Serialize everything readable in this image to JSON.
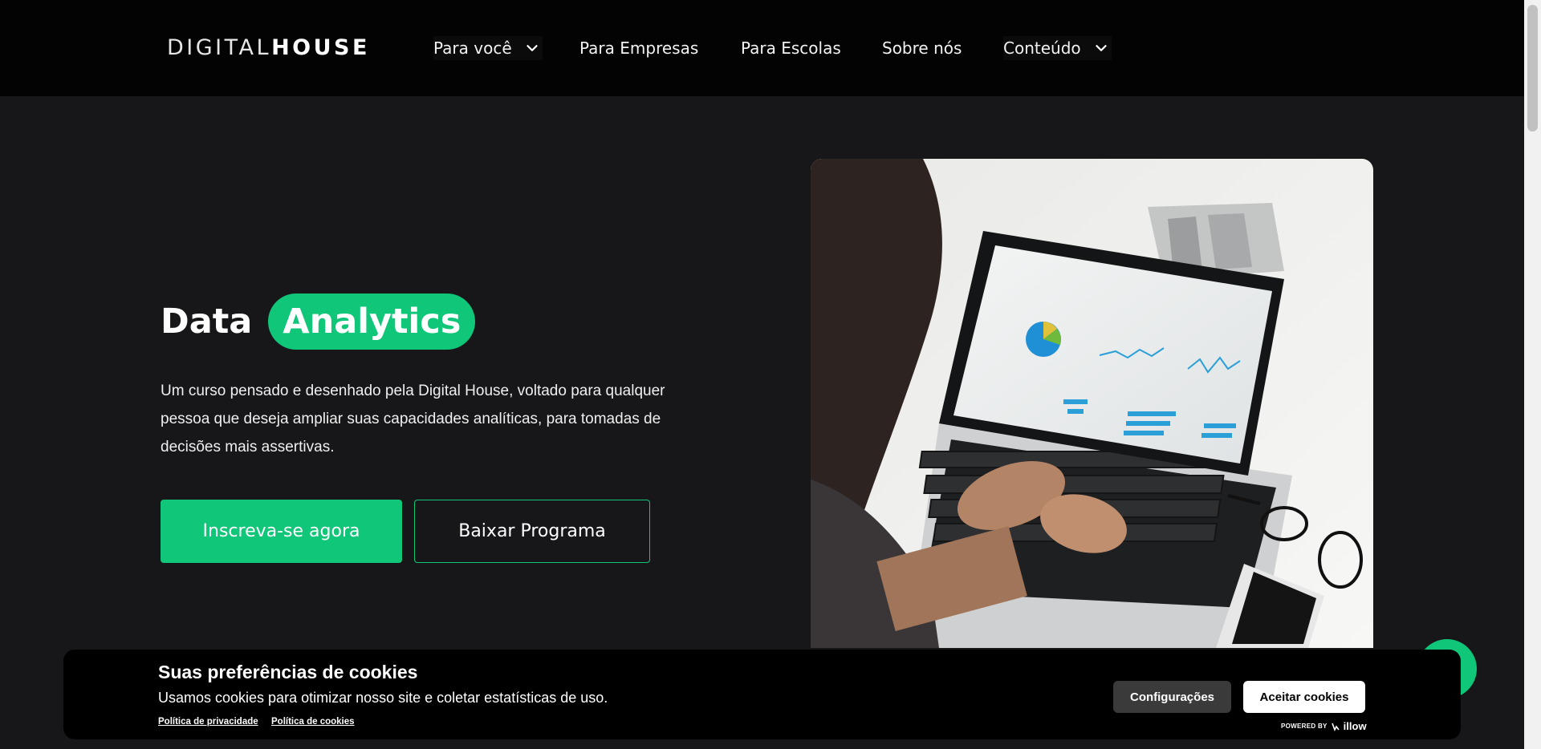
{
  "header": {
    "logo_thin": "DIGITAL",
    "logo_bold": "HOUSE",
    "nav": [
      {
        "label": "Para você",
        "dropdown": true
      },
      {
        "label": "Para Empresas",
        "dropdown": false
      },
      {
        "label": "Para Escolas",
        "dropdown": false
      },
      {
        "label": "Sobre nós",
        "dropdown": false
      },
      {
        "label": "Conteúdo",
        "dropdown": true
      }
    ]
  },
  "hero": {
    "title_word": "Data",
    "title_highlight": "Analytics",
    "description": "Um curso pensado e desenhado pela Digital House, voltado para qualquer pessoa que deseja ampliar suas capacidades analíticas, para tomadas de decisões mais assertivas.",
    "primary_button": "Inscreva-se agora",
    "secondary_button": "Baixar Programa",
    "image_icon": "laptop-analytics-photo"
  },
  "cookie_banner": {
    "title": "Suas preferências de cookies",
    "text": "Usamos cookies para otimizar nosso site e coletar estatísticas de uso.",
    "privacy_link": "Política de privacidade",
    "cookie_link": "Política de cookies",
    "settings_button": "Configurações",
    "accept_button": "Aceitar cookies",
    "powered_by": "POWERED BY",
    "powered_brand": "illow"
  },
  "colors": {
    "accent": "#10c679",
    "background": "#17171a",
    "header": "#030303"
  }
}
